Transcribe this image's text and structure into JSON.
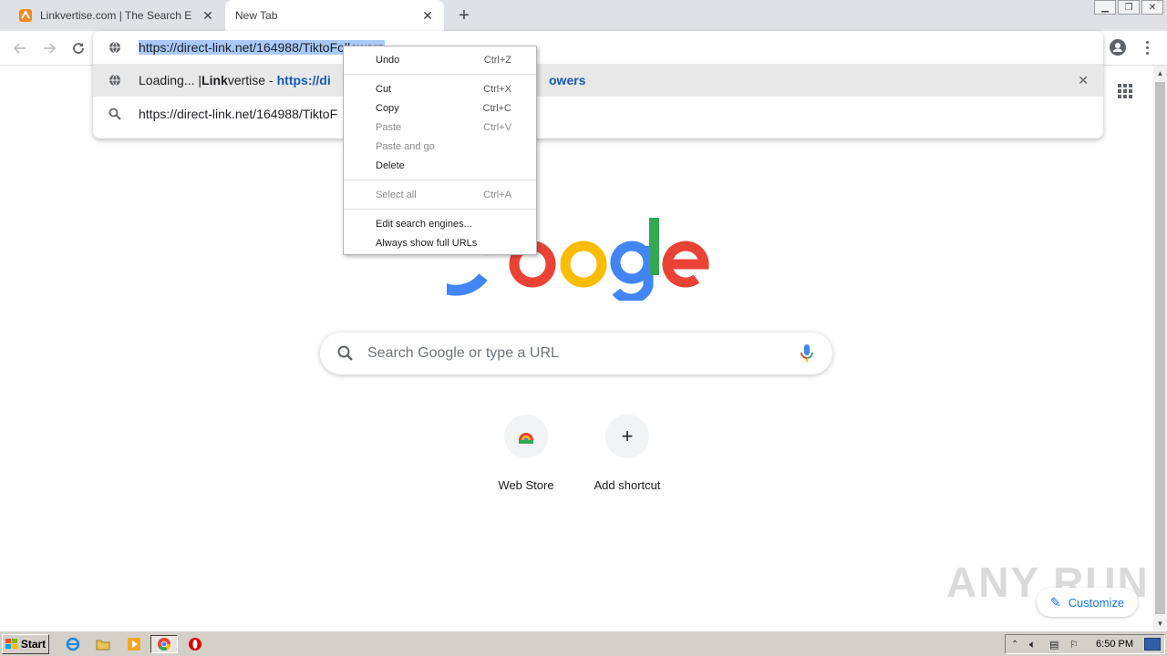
{
  "tabs": [
    {
      "title": "Linkvertise.com | The Search Engine",
      "favicon": "linkvertise-icon",
      "active": false
    },
    {
      "title": "New Tab",
      "active": true
    }
  ],
  "omnibox": {
    "url_selected": "https://direct-link.net/164988/TiktoFollowers",
    "suggestion1": {
      "pre": "Loading... | ",
      "bold": "Link",
      "post": "vertise - ",
      "url_a": "https://di",
      "url_b": "owers"
    },
    "suggestion2": "https://direct-link.net/164988/TiktoF"
  },
  "context_menu": {
    "items": [
      {
        "label": "Undo",
        "shortcut": "Ctrl+Z",
        "enabled": true
      },
      {
        "label": "Cut",
        "shortcut": "Ctrl+X",
        "enabled": true
      },
      {
        "label": "Copy",
        "shortcut": "Ctrl+C",
        "enabled": true
      },
      {
        "label": "Paste",
        "shortcut": "Ctrl+V",
        "enabled": false
      },
      {
        "label": "Paste and go",
        "shortcut": "",
        "enabled": false
      },
      {
        "label": "Delete",
        "shortcut": "",
        "enabled": true
      },
      {
        "label": "Select all",
        "shortcut": "Ctrl+A",
        "enabled": false
      },
      {
        "label": "Edit search engines...",
        "shortcut": "",
        "enabled": true
      },
      {
        "label": "Always show full URLs",
        "shortcut": "",
        "enabled": true
      }
    ]
  },
  "ntp": {
    "search_placeholder": "Search Google or type a URL",
    "shortcuts": [
      {
        "label": "Web Store",
        "icon": "web-store-icon"
      },
      {
        "label": "Add shortcut",
        "icon": "plus-icon"
      }
    ],
    "customize_label": "Customize",
    "watermark": "ANY RUN"
  },
  "taskbar": {
    "start_label": "Start",
    "clock": "6:50 PM",
    "apps": [
      "internet-explorer-icon",
      "folder-icon",
      "media-player-icon",
      "chrome-icon",
      "opera-icon"
    ]
  },
  "colors": {
    "google_blue": "#4285f4",
    "google_red": "#ea4335",
    "google_yellow": "#fbbc05",
    "google_green": "#34a853",
    "accent": "#1a73e8"
  }
}
